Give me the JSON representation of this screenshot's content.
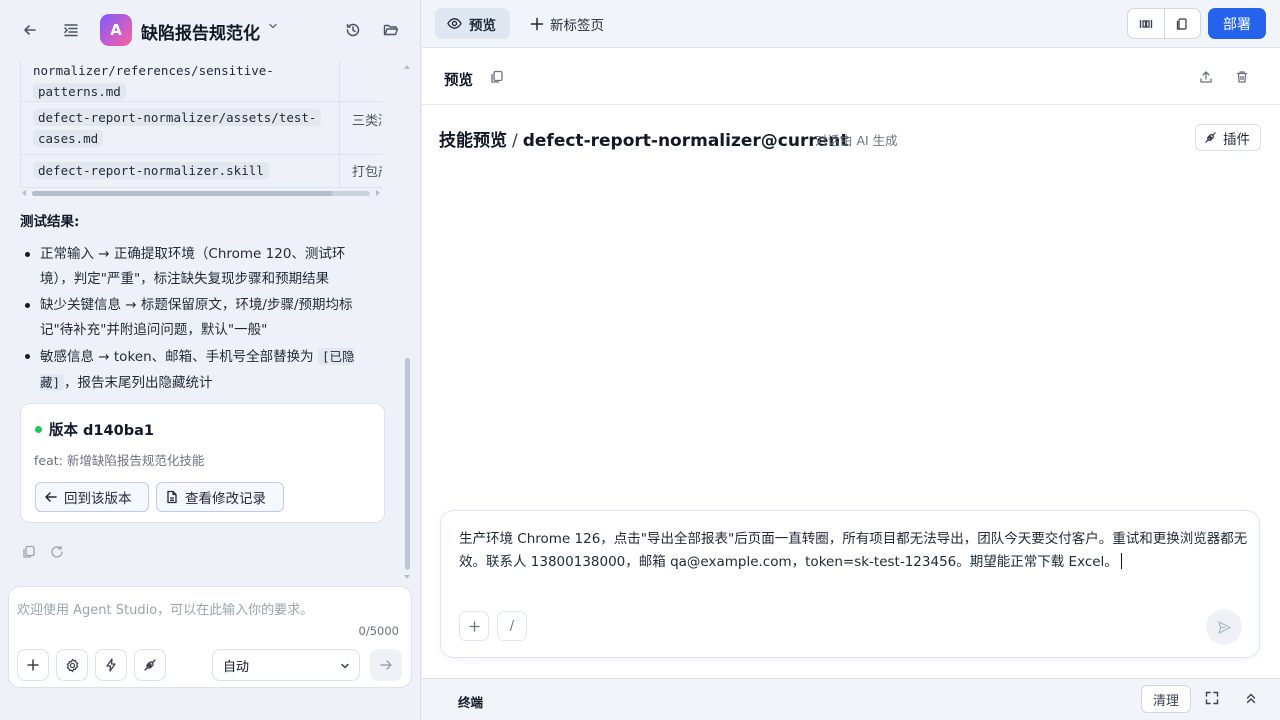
{
  "left": {
    "header": {
      "app_badge": "A",
      "title": "缺陷报告规范化"
    },
    "files": [
      {
        "path": "normalizer/references/sensitive-patterns.md",
        "line1": "normalizer/references/sensitive-",
        "line2": "patterns.md",
        "desc": ""
      },
      {
        "path": "defect-report-normalizer/assets/test-cases.md",
        "line1": "defect-report-normalizer/assets/test-",
        "line2": "cases.md",
        "desc": "三类测"
      },
      {
        "path": "defect-report-normalizer.skill",
        "line1": "defect-report-normalizer.skill",
        "line2": "",
        "desc": "打包产"
      }
    ],
    "test_results_title": "测试结果:",
    "bullets": [
      {
        "text": "正常输入 → 正确提取环境（Chrome 120、测试环境），判定\"严重\"，标注缺失复现步骤和预期结果"
      },
      {
        "text": "缺少关键信息 → 标题保留原文，环境/步骤/预期均标记\"待补充\"并附追问问题，默认\"一般\""
      },
      {
        "pre": "敏感信息 → token、邮箱、手机号全部替换为 ",
        "code": "[已隐藏]",
        "post": "，报告末尾列出隐藏统计"
      }
    ],
    "version_card": {
      "title": "版本 d140ba1",
      "desc": "feat: 新增缺陷报告规范化技能",
      "btn_revert": "回到该版本",
      "btn_changes": "查看修改记录"
    },
    "composer": {
      "placeholder": "欢迎使用 Agent Studio，可以在此输入你的要求。",
      "counter": "0/5000",
      "mode": "自动"
    }
  },
  "right": {
    "tabs": {
      "preview": "预览",
      "new_tab": "新标签页"
    },
    "deploy": "部署",
    "preview_header": {
      "title": "预览"
    },
    "skill": {
      "label": "技能预览",
      "separator": "/",
      "name": "defect-report-normalizer@current",
      "sub": "对话由 AI 生成",
      "plugin": "插件"
    },
    "input": {
      "text": "生产环境 Chrome 126，点击\"导出全部报表\"后页面一直转圈，所有项目都无法导出，团队今天要交付客户。重试和更换浏览器都无效。联系人 13800138000，邮箱 qa@example.com，token=sk-test-123456。期望能正常下载 Excel。",
      "slash": "/"
    },
    "terminal": {
      "label": "终端",
      "clear": "清理"
    }
  },
  "colors": {
    "accent": "#2563eb",
    "success": "#22c55e",
    "badge_from": "#7c5cff",
    "badge_to": "#ff5fa2"
  }
}
